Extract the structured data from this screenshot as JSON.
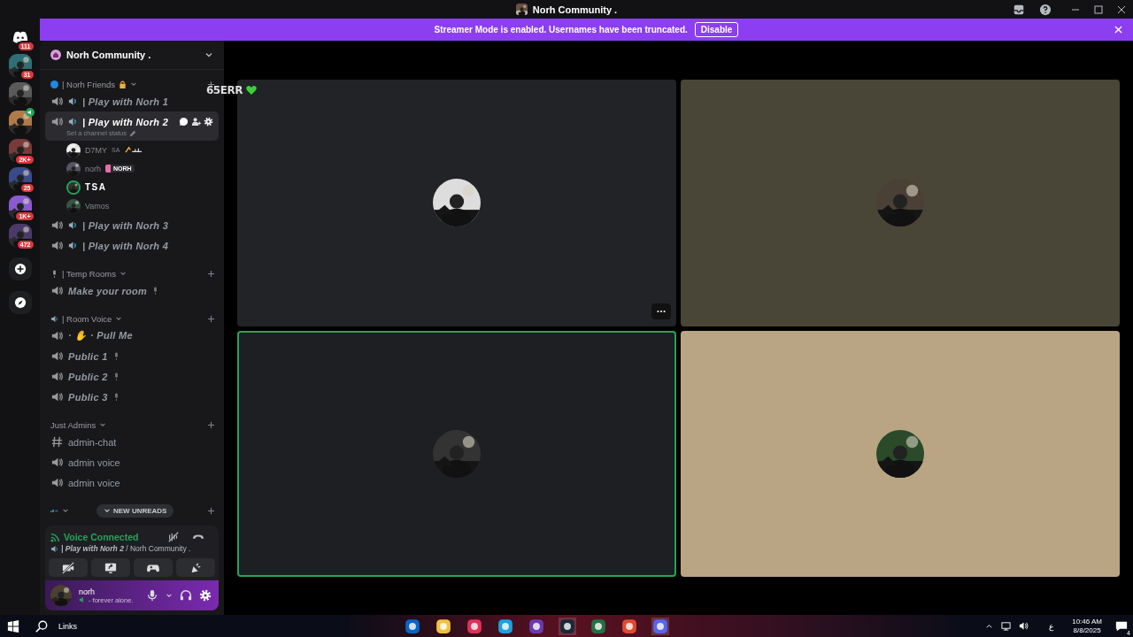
{
  "window": {
    "title": "Norh Community ."
  },
  "banner": {
    "text": "Streamer Mode is enabled. Usernames have been truncated.",
    "button": "Disable"
  },
  "servers": [
    {
      "kind": "home",
      "badge": "111"
    },
    {
      "kind": "server",
      "badge": "31",
      "voice": false
    },
    {
      "kind": "server",
      "voice": false
    },
    {
      "kind": "server",
      "voice": true
    },
    {
      "kind": "server",
      "badge": "2K+",
      "voice": false
    },
    {
      "kind": "server",
      "badge": "25",
      "voice": false
    },
    {
      "kind": "server",
      "badge": "1K+",
      "voice": false
    },
    {
      "kind": "server",
      "badge": "472",
      "voice": false
    }
  ],
  "server_name": "Norh Community .",
  "overlay": {
    "text": "65ERR"
  },
  "categories": [
    {
      "kind": "dot",
      "name": "| Norh Friends",
      "channels": [
        {
          "kind": "voice-speaker",
          "name": "| Play with Norh 1",
          "selected": false
        },
        {
          "kind": "voice-speaker",
          "name": "| Play with Norh 2",
          "selected": true,
          "status": "Set a channel status",
          "members": [
            {
              "name": "D7MY",
              "tag": "SA",
              "speaking": false
            },
            {
              "name": "norh",
              "tag": "NORH",
              "speaking": false
            },
            {
              "name": "TSA",
              "speaking": true
            },
            {
              "name": "Vamos",
              "speaking": false
            }
          ]
        },
        {
          "kind": "voice-speaker",
          "name": "| Play with Norh 3",
          "selected": false
        },
        {
          "kind": "voice-speaker",
          "name": "| Play with Norh 4",
          "selected": false
        }
      ]
    },
    {
      "kind": "mic",
      "name": "| Temp Rooms",
      "channels": [
        {
          "kind": "voice",
          "name": "Make your room",
          "selected": false
        }
      ]
    },
    {
      "kind": "speaker",
      "name": "| Room Voice",
      "channels": [
        {
          "kind": "voice",
          "name": "· ✋ · Pull Me",
          "selected": false
        },
        {
          "kind": "voice",
          "name": "Public 1",
          "selected": false
        },
        {
          "kind": "voice",
          "name": "Public 2",
          "selected": false
        },
        {
          "kind": "voice",
          "name": "Public 3",
          "selected": false
        }
      ]
    },
    {
      "kind": "plain",
      "name": "Just Admins",
      "channels": [
        {
          "kind": "text",
          "name": "admin-chat",
          "selected": false
        },
        {
          "kind": "voice",
          "name": "admin voice",
          "selected": false
        },
        {
          "kind": "voice",
          "name": "admin voice",
          "selected": false
        }
      ]
    },
    {
      "kind": "icon"
    }
  ],
  "new_unreads": "NEW UNREADS",
  "voice": {
    "title": "Voice Connected",
    "location": "**| Play with Norh 2** / Norh Community ."
  },
  "user": {
    "name": "norh",
    "status": "- forever alone."
  },
  "tiles": [
    {
      "color": "#222326",
      "speaking": false,
      "more": true
    },
    {
      "color": "#4a4637",
      "speaking": false,
      "more": false
    },
    {
      "color": "#1e1f22",
      "speaking": true,
      "more": false
    },
    {
      "color": "#b9a583",
      "speaking": false,
      "more": false
    }
  ],
  "taskbar": {
    "search": "Links",
    "time": "10:46 AM",
    "date": "8/8/2025",
    "language": "ع",
    "notifications": "4"
  }
}
